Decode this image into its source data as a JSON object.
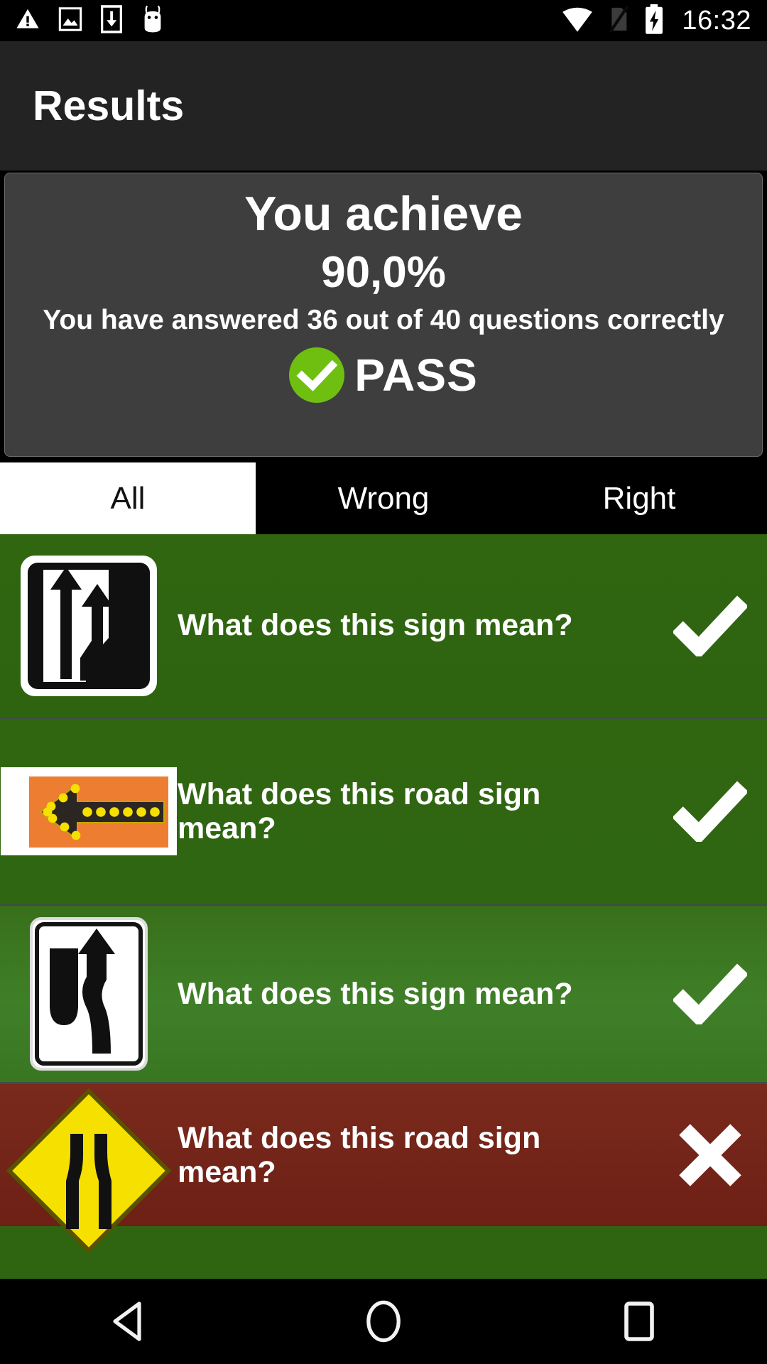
{
  "status_bar": {
    "time": "16:32",
    "left_icons": [
      "warning-triangle-icon",
      "image-icon",
      "download-icon",
      "android-bug-icon"
    ],
    "right_icons": [
      "wifi-icon",
      "no-sim-icon",
      "battery-charging-icon"
    ]
  },
  "app_bar": {
    "title": "Results"
  },
  "result_card": {
    "achieve_label": "You achieve",
    "percent": "90,0%",
    "detail": "You have answered 36 out of 40 questions correctly",
    "verdict": "PASS",
    "verdict_icon": "check-circle-icon",
    "verdict_color": "#6fbf11",
    "correct_count": 36,
    "total_count": 40
  },
  "tabs": [
    {
      "label": "All",
      "selected": true
    },
    {
      "label": "Wrong",
      "selected": false
    },
    {
      "label": "Right",
      "selected": false
    }
  ],
  "questions": [
    {
      "text": "What does this sign mean?",
      "result": "correct",
      "mark": "check-icon",
      "sign": "lane-merge-sign"
    },
    {
      "text": "What does this road sign mean?",
      "result": "correct",
      "mark": "check-icon",
      "sign": "orange-flashing-arrow-left-sign"
    },
    {
      "text": "What does this sign mean?",
      "result": "correct",
      "mark": "check-icon",
      "sign": "pass-obstruction-right-sign"
    },
    {
      "text": "What does this road sign mean?",
      "result": "wrong",
      "mark": "cross-icon",
      "sign": "road-narrows-warning-sign"
    }
  ],
  "nav_bar": {
    "back": "back-icon",
    "home": "home-icon",
    "recents": "recents-icon"
  },
  "colors": {
    "correct_row": "#2f6510",
    "wrong_row": "#72221a",
    "accent_green": "#6fbf11",
    "card_bg": "#3e3e3e",
    "app_bar_bg": "#232323"
  }
}
